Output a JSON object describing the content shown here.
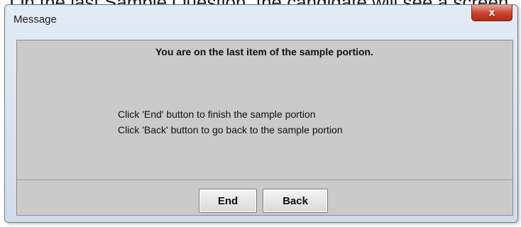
{
  "background": {
    "caption_text": "On the last Sample Question, the candidate will see a screen"
  },
  "dialog": {
    "title": "Message",
    "close_label": "x",
    "heading": "You are on the last item of the sample portion.",
    "lines": [
      "Click 'End' button to finish the sample portion",
      "Click 'Back' button to go back to the sample portion"
    ],
    "buttons": {
      "end": "End",
      "back": "Back"
    }
  },
  "colors": {
    "titlebar": "#dbe5ef",
    "content_bg": "#cacaca",
    "close_button": "#c9402b"
  }
}
